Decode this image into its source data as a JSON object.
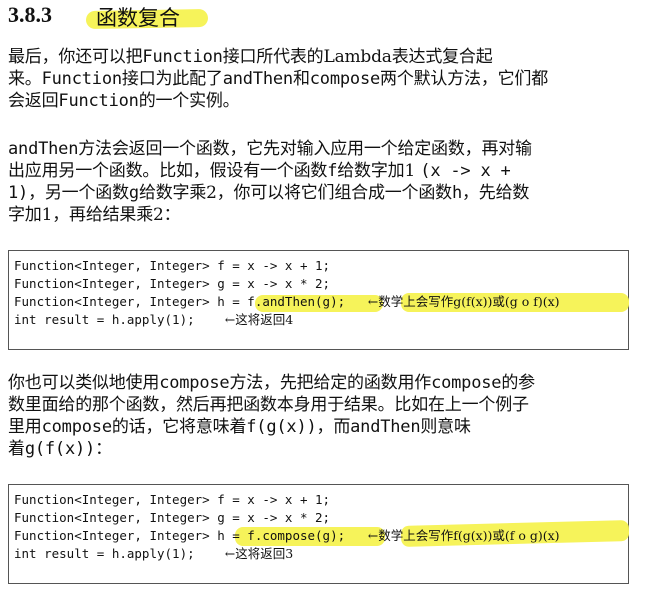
{
  "section": {
    "number": "3.8.3",
    "title": "函数复合"
  },
  "paragraphs": {
    "p1": [
      [
        "最后，你还可以把",
        "Function",
        "接口所代表的Lambda表达式复合起"
      ],
      [
        "来。",
        "Function",
        "接口为此配了",
        "andThen",
        "和",
        "compose",
        "两个默认方法，它们都"
      ],
      [
        "会返回",
        "Function",
        "的一个实例。"
      ]
    ],
    "p2": [
      [
        "andThen",
        "方法会返回一个函数，它先对输入应用一个给定函数，再对输"
      ],
      [
        "出应用另一个函数。比如，假设有一个函数",
        "f",
        "给数字加1 ",
        "(x -> x +"
      ],
      [
        "1)",
        "，另一个函数",
        "g",
        "给数字乘2，你可以将它们组合成一个函数",
        "h",
        "，先给数"
      ],
      [
        "字加1，再给结果乘2："
      ]
    ],
    "p3": [
      [
        "你也可以类似地使用",
        "compose",
        "方法，先把给定的函数用作",
        "compose",
        "的参"
      ],
      [
        "数里面给的那个函数，然后再把函数本身用于结果。比如在上一个例子"
      ],
      [
        "里用",
        "compose",
        "的话，它将意味着",
        "f(g(x))",
        "，而",
        "andThen",
        "则意味"
      ],
      [
        "着",
        "g(f(x))",
        "："
      ]
    ]
  },
  "code1": {
    "line1": "Function<Integer, Integer> f = x -> x + 1;",
    "line2": "Function<Integer, Integer> g = x -> x * 2;",
    "line3_code": "Function<Integer, Integer> h = f.andThen(g);",
    "line3_anno": "←数学上会写作g(f(x))或(g o f)(x)",
    "line4_code": "int result = h.apply(1);",
    "line4_anno": "←这将返回4"
  },
  "code2": {
    "line1": "Function<Integer, Integer> f = x -> x + 1;",
    "line2": "Function<Integer, Integer> g = x -> x * 2;",
    "line3_code": "Function<Integer, Integer> h = f.compose(g);",
    "line3_anno": "←数学上会写作f(g(x))或(f o g)(x)",
    "line4_code": "int result = h.apply(1);",
    "line4_anno": "←这将返回3"
  },
  "colors": {
    "highlight": "#f6f35a",
    "text": "#111111",
    "border": "#555555"
  }
}
